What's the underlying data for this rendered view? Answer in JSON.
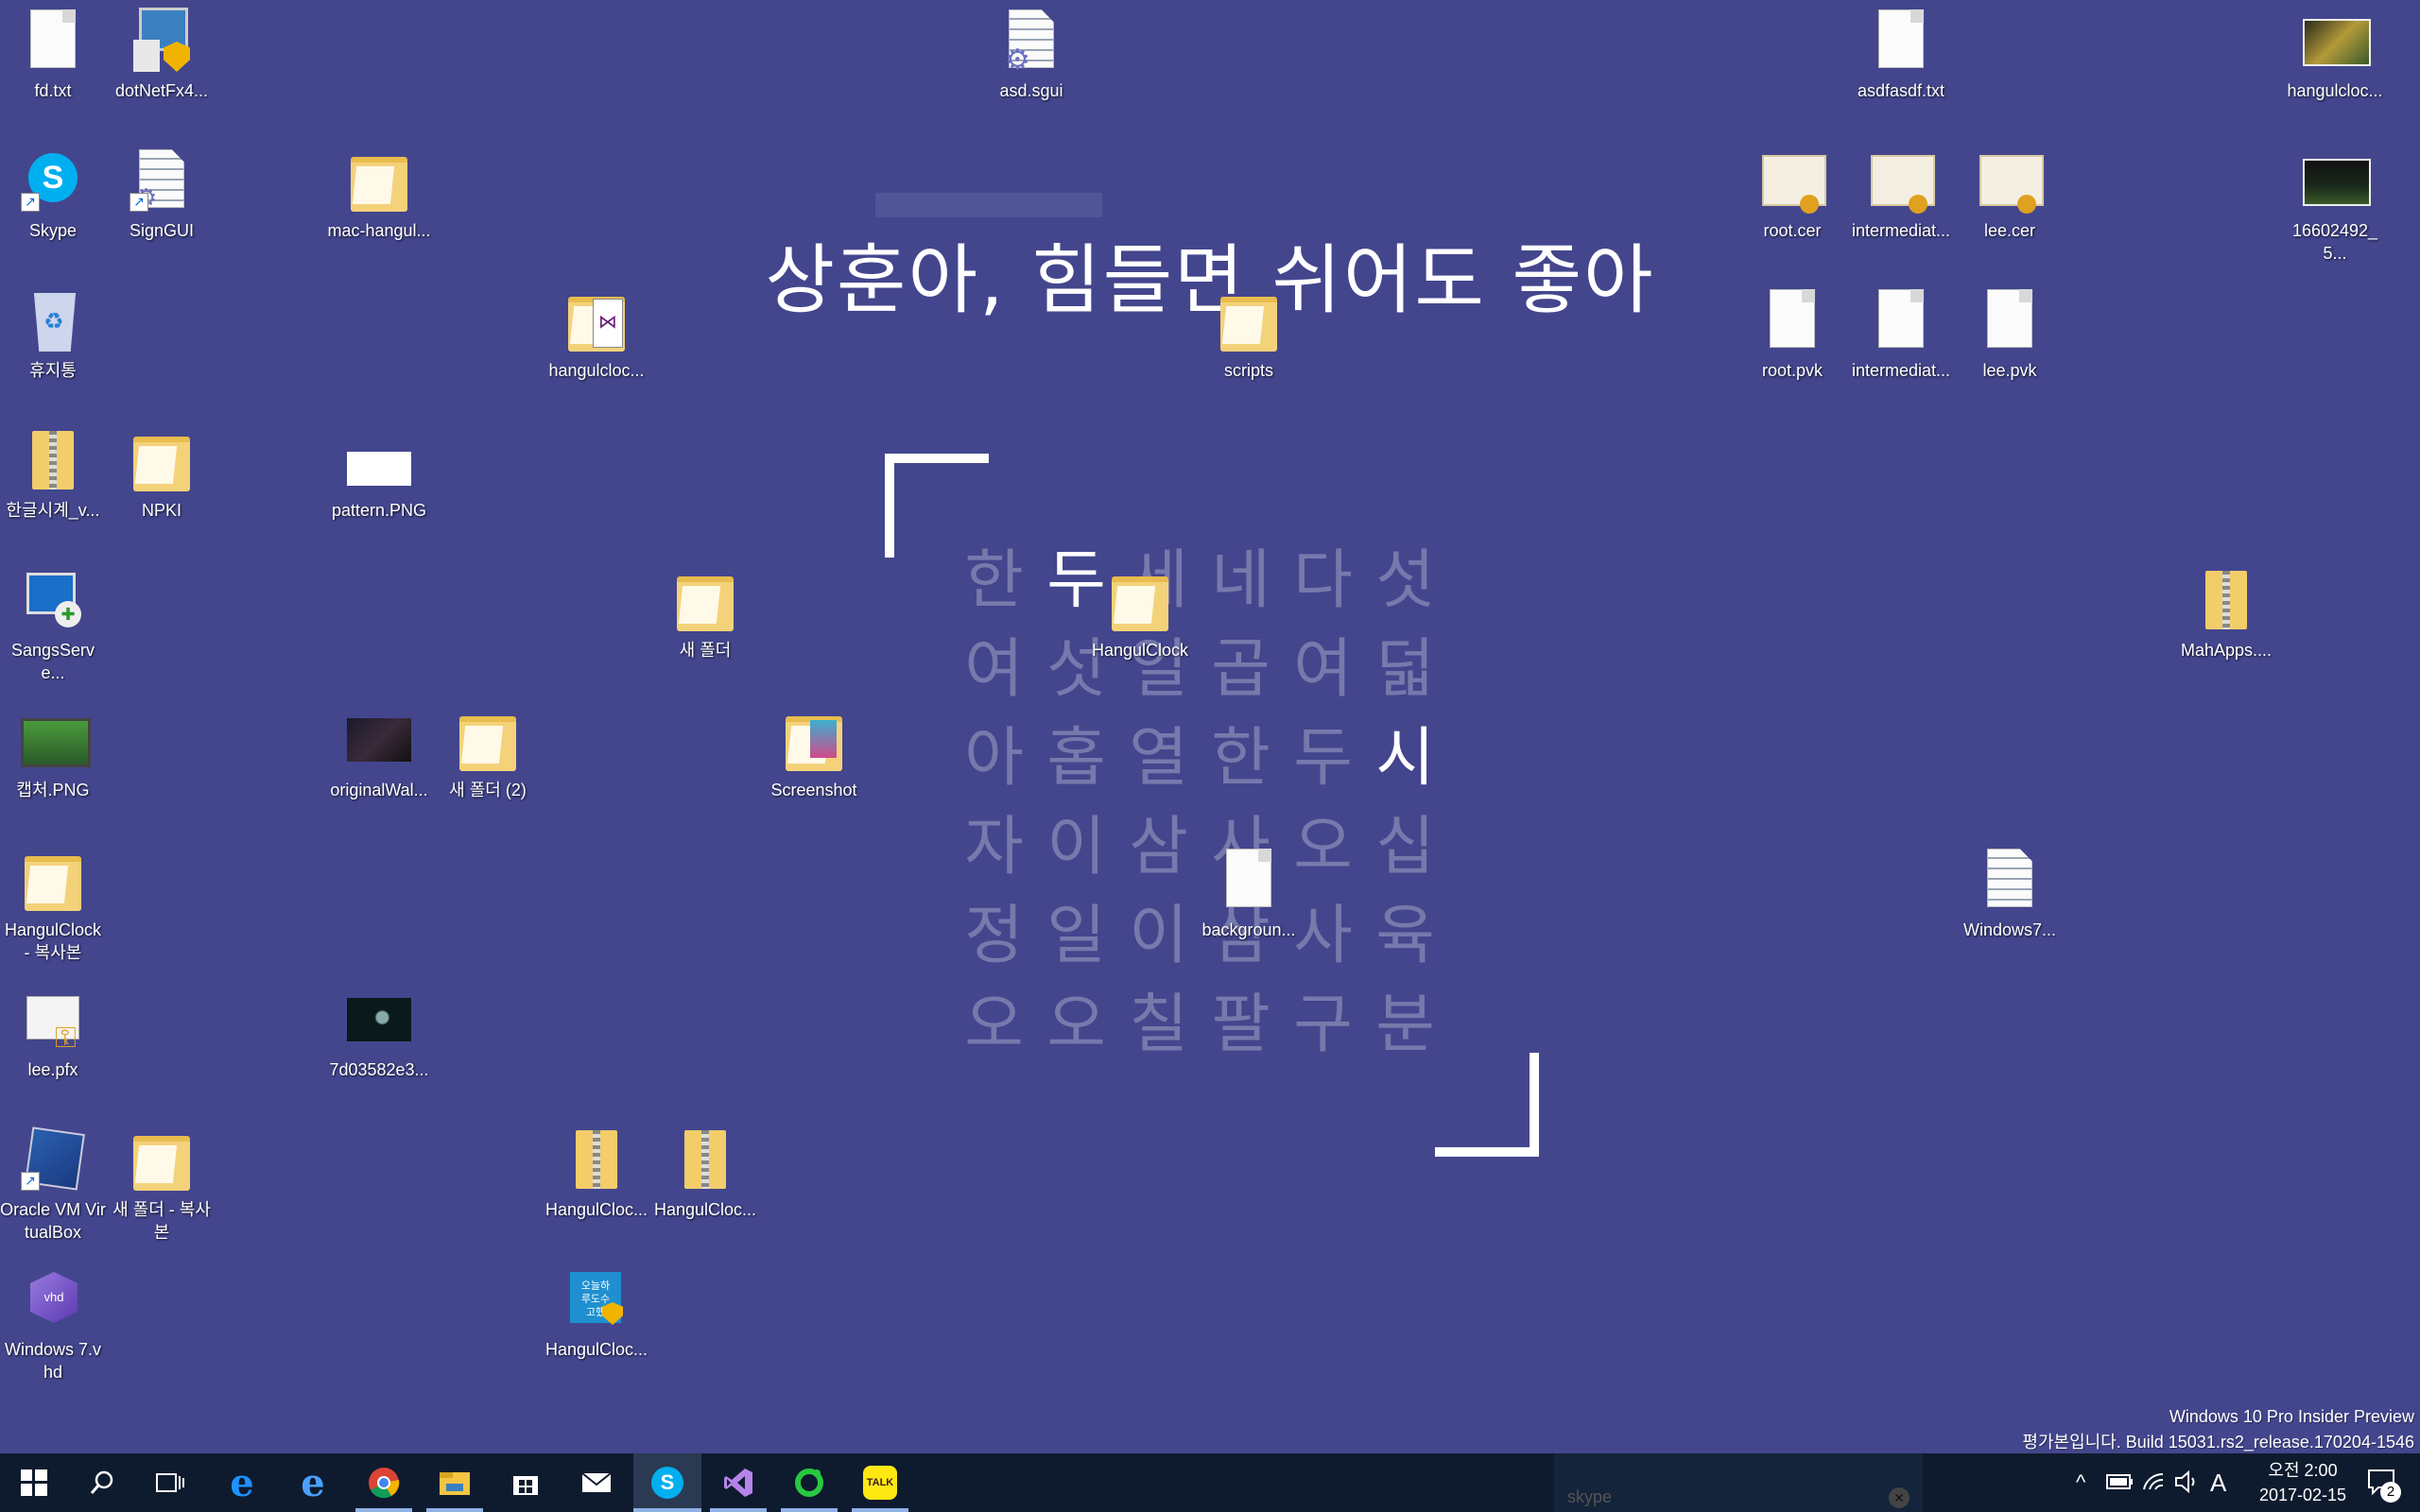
{
  "clock": {
    "title": "상훈아, 힘들면 쉬어도 좋아",
    "rows": [
      [
        "한",
        "두",
        "세",
        "네",
        "다",
        "섯"
      ],
      [
        "여",
        "섯",
        "일",
        "곱",
        "여",
        "덟"
      ],
      [
        "아",
        "홉",
        "열",
        "한",
        "두",
        "시"
      ],
      [
        "자",
        "이",
        "삼",
        "사",
        "오",
        "십"
      ],
      [
        "정",
        "일",
        "이",
        "삼",
        "사",
        "육"
      ],
      [
        "오",
        "오",
        "칠",
        "팔",
        "구",
        "분"
      ]
    ],
    "highlighted": [
      "0-1",
      "2-5"
    ]
  },
  "desktop_icons": [
    {
      "label": "fd.txt",
      "icon": "text-file-icon"
    },
    {
      "label": "dotNetFx4...",
      "icon": "installer-icon"
    },
    {
      "label": "asd.sgui",
      "icon": "settings-file-icon"
    },
    {
      "label": "asdfasdf.txt",
      "icon": "text-file-icon"
    },
    {
      "label": "hangulcloc...",
      "icon": "image-thumbnail-icon"
    },
    {
      "label": "Skype",
      "icon": "skype-icon"
    },
    {
      "label": "SignGUI",
      "icon": "program-shortcut-icon"
    },
    {
      "label": "mac-hangul...",
      "icon": "folder-icon"
    },
    {
      "label": "root.cer",
      "icon": "certificate-icon"
    },
    {
      "label": "intermediat...",
      "icon": "certificate-icon"
    },
    {
      "label": "lee.cer",
      "icon": "certificate-icon"
    },
    {
      "label": "16602492_5...",
      "icon": "image-thumbnail-icon"
    },
    {
      "label": "휴지통",
      "icon": "recycle-bin-icon"
    },
    {
      "label": "hangulcloc...",
      "icon": "visual-studio-folder-icon"
    },
    {
      "label": "scripts",
      "icon": "folder-icon"
    },
    {
      "label": "root.pvk",
      "icon": "blank-file-icon"
    },
    {
      "label": "intermediat...",
      "icon": "blank-file-icon"
    },
    {
      "label": "lee.pvk",
      "icon": "blank-file-icon"
    },
    {
      "label": "한글시계_v...",
      "icon": "zip-folder-icon"
    },
    {
      "label": "NPKI",
      "icon": "folder-icon"
    },
    {
      "label": "pattern.PNG",
      "icon": "image-thumbnail-icon"
    },
    {
      "label": "SangsServe...",
      "icon": "remote-desktop-icon"
    },
    {
      "label": "새 폴더",
      "icon": "folder-icon"
    },
    {
      "label": "HangulClock",
      "icon": "folder-icon"
    },
    {
      "label": "MahApps....",
      "icon": "zip-folder-icon"
    },
    {
      "label": "캡처.PNG",
      "icon": "image-thumbnail-icon"
    },
    {
      "label": "originalWal...",
      "icon": "image-thumbnail-icon"
    },
    {
      "label": "새 폴더 (2)",
      "icon": "folder-icon"
    },
    {
      "label": "Screenshot",
      "icon": "folder-icon"
    },
    {
      "label": "HangulClock - 복사본",
      "icon": "folder-icon"
    },
    {
      "label": "backgroun...",
      "icon": "blank-file-icon"
    },
    {
      "label": "Windows7...",
      "icon": "text-file-icon"
    },
    {
      "label": "lee.pfx",
      "icon": "pfx-file-icon"
    },
    {
      "label": "7d03582e3...",
      "icon": "image-thumbnail-icon"
    },
    {
      "label": "Oracle VM VirtualBox",
      "icon": "virtualbox-icon"
    },
    {
      "label": "새 폴더 - 복사본",
      "icon": "folder-icon"
    },
    {
      "label": "HangulCloc...",
      "icon": "zip-folder-icon"
    },
    {
      "label": "HangulCloc...",
      "icon": "zip-folder-icon"
    },
    {
      "label": "Windows 7.vhd",
      "icon": "vhd-icon"
    },
    {
      "label": "HangulCloc...",
      "icon": "hangul-app-icon"
    }
  ],
  "watermark": {
    "line1": "Windows 10 Pro Insider Preview",
    "line2": "평가본입니다. Build 15031.rs2_release.170204-1546"
  },
  "taskbar": {
    "apps": [
      {
        "name": "start-button",
        "glyph": "⊞"
      },
      {
        "name": "search-button",
        "glyph": "⌕"
      },
      {
        "name": "task-view-button",
        "glyph": "❐"
      },
      {
        "name": "edge-icon",
        "glyph": "e"
      },
      {
        "name": "internet-explorer-icon",
        "glyph": "e"
      },
      {
        "name": "chrome-icon",
        "glyph": "◉"
      },
      {
        "name": "file-explorer-icon",
        "glyph": "▬"
      },
      {
        "name": "store-icon",
        "glyph": "▦"
      },
      {
        "name": "mail-icon",
        "glyph": "✉"
      },
      {
        "name": "skype-taskbar-icon",
        "glyph": "S"
      },
      {
        "name": "visual-studio-icon",
        "glyph": "⋈"
      },
      {
        "name": "line-app-icon",
        "glyph": "◯"
      },
      {
        "name": "kakaotalk-icon",
        "glyph": "TALK"
      }
    ],
    "skype_preview_label": "skype",
    "ime_indicator": "A",
    "time": "오전 2:00",
    "date": "2017-02-15",
    "notification_count": "2",
    "colors": {
      "background": "#0e1b2e",
      "accent": "#8fb2e6"
    }
  },
  "colors": {
    "desktop": "#43468d"
  }
}
